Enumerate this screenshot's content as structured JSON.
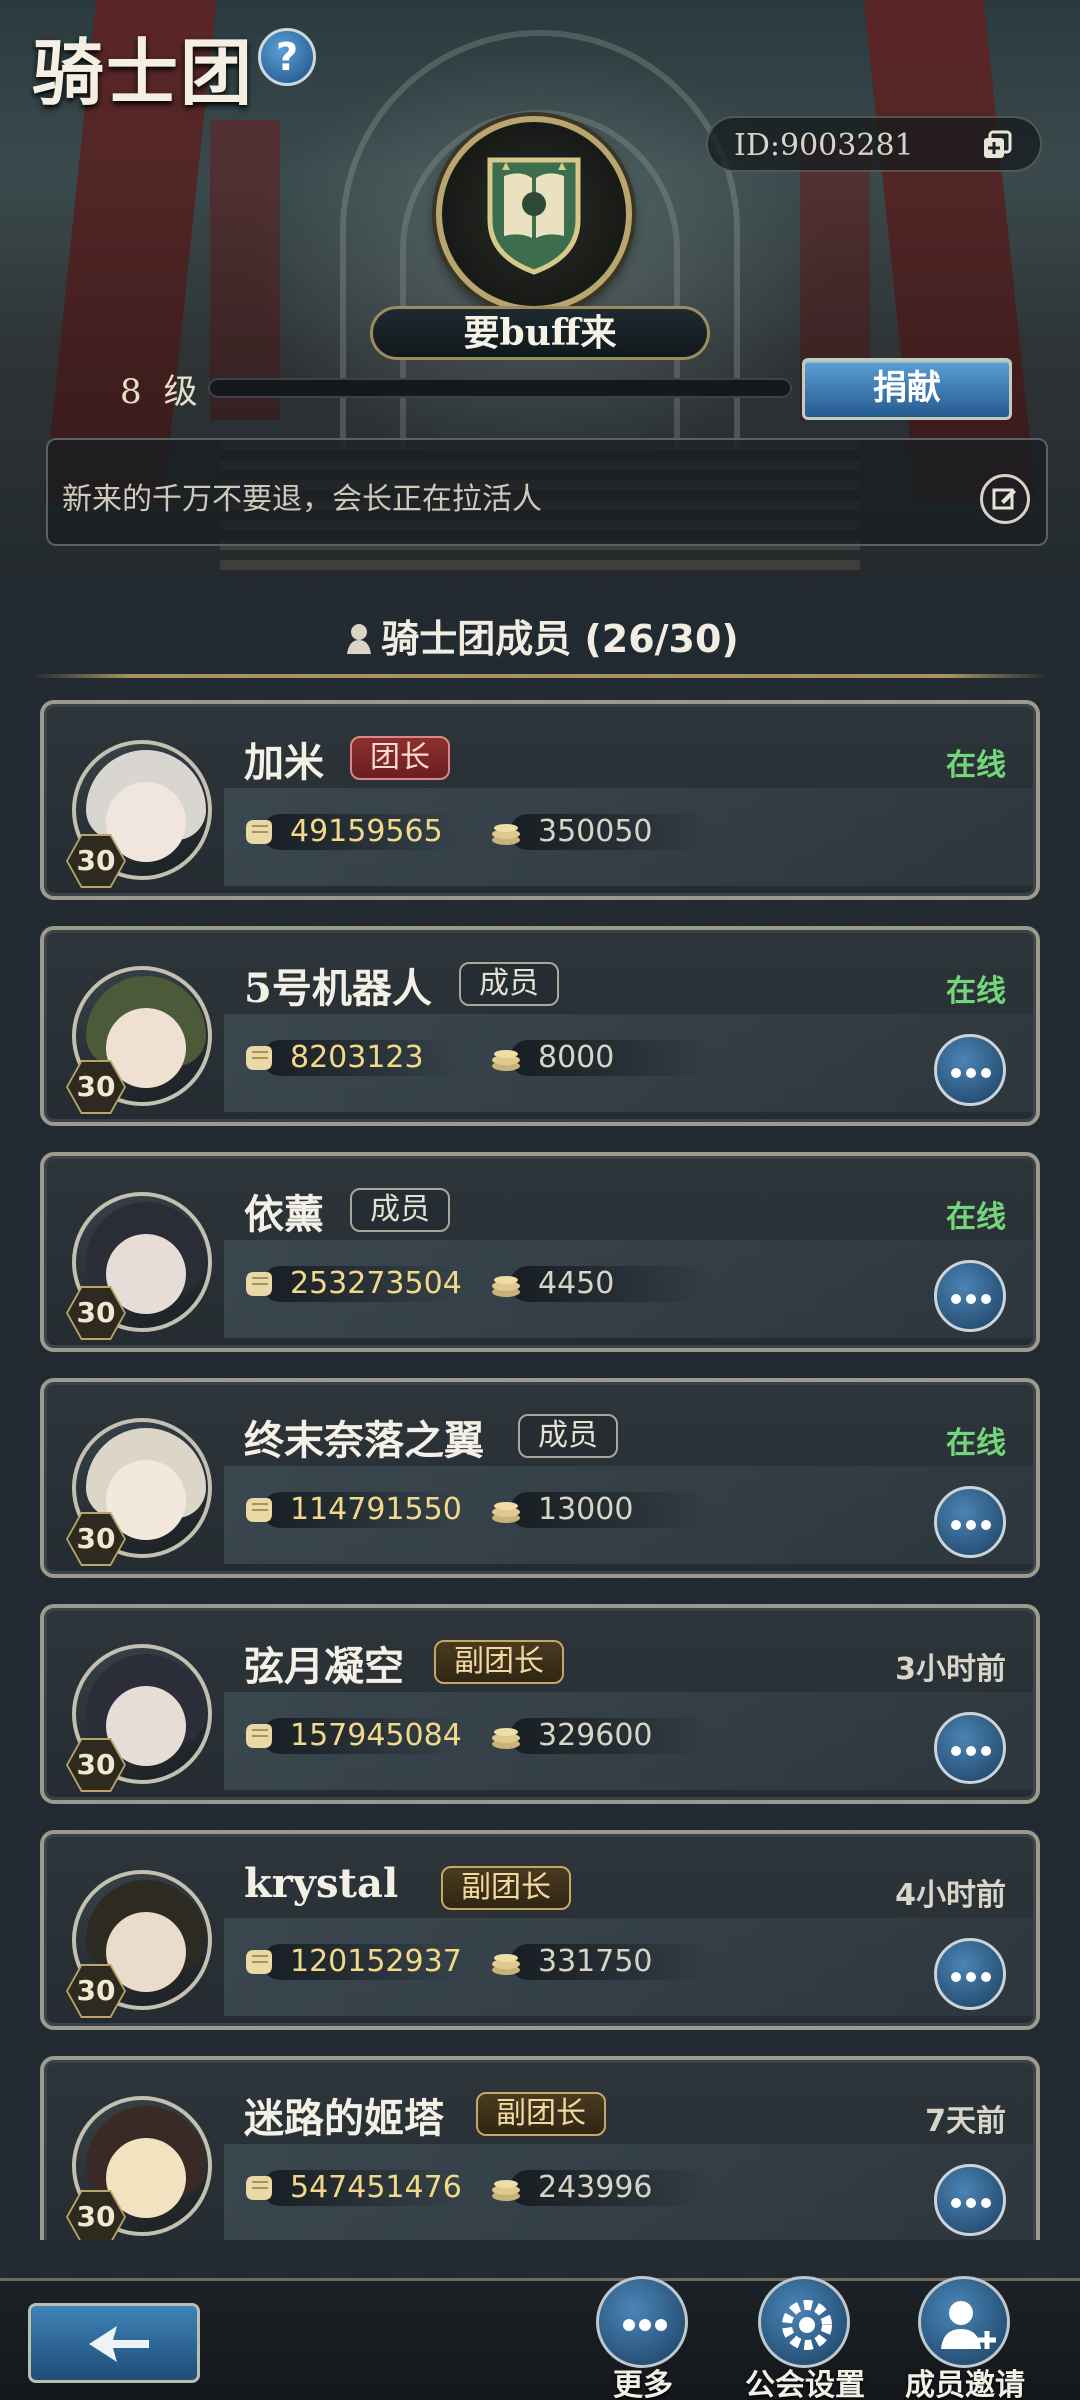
{
  "header": {
    "title": "骑士团",
    "help_icon": "question-mark-icon",
    "guild_id": "ID:9003281",
    "guild_name": "要buff来",
    "level_number": "8",
    "level_unit": "级",
    "exp_fraction": 0.0,
    "donate_label": "捐献",
    "notice": "新来的千万不要退，会长正在拉活人"
  },
  "members": {
    "title": "骑士团成员 (26/30)",
    "list": [
      {
        "name": "加米",
        "role": "团长",
        "role_type": "leader",
        "status": "在线",
        "online": true,
        "level": "30",
        "power": "49159565",
        "coins": "350050",
        "has_more": false
      },
      {
        "name": "5号机器人",
        "role": "成员",
        "role_type": "member",
        "status": "在线",
        "online": true,
        "level": "30",
        "power": "8203123",
        "coins": "8000",
        "has_more": true
      },
      {
        "name": "依薰",
        "role": "成员",
        "role_type": "member",
        "status": "在线",
        "online": true,
        "level": "30",
        "power": "253273504",
        "coins": "4450",
        "has_more": true
      },
      {
        "name": "终末奈落之翼",
        "role": "成员",
        "role_type": "member",
        "status": "在线",
        "online": true,
        "level": "30",
        "power": "114791550",
        "coins": "13000",
        "has_more": true
      },
      {
        "name": "弦月凝空",
        "role": "副团长",
        "role_type": "vice",
        "status": "3小时前",
        "online": false,
        "level": "30",
        "power": "157945084",
        "coins": "329600",
        "has_more": true
      },
      {
        "name": "krystal",
        "role": "副团长",
        "role_type": "vice",
        "status": "4小时前",
        "online": false,
        "level": "30",
        "power": "120152937",
        "coins": "331750",
        "has_more": true
      },
      {
        "name": "迷路的姬塔",
        "role": "副团长",
        "role_type": "vice",
        "status": "7天前",
        "online": false,
        "level": "30",
        "power": "547451476",
        "coins": "243996",
        "has_more": true
      }
    ]
  },
  "bottom_bar": {
    "back_icon": "back-arrow-icon",
    "more_label": "更多",
    "settings_label": "公会设置",
    "invite_label": "成员邀请"
  },
  "colors": {
    "online": "#74d67a",
    "leader_badge": "#8e2f2f",
    "vice_badge": "#c7a860",
    "accent_blue": "#3f83b6"
  }
}
